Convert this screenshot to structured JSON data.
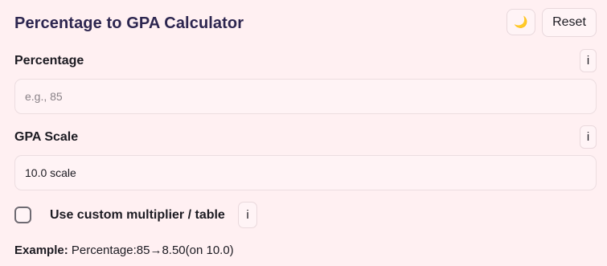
{
  "header": {
    "title": "Percentage to GPA Calculator",
    "theme_toggle_icon": "moon-icon",
    "reset_label": "Reset"
  },
  "percentage": {
    "label": "Percentage",
    "info_label": "i",
    "value": "",
    "placeholder": "e.g., 85"
  },
  "gpa_scale": {
    "label": "GPA Scale",
    "info_label": "i",
    "selected": "10.0 scale"
  },
  "custom": {
    "checked": false,
    "label": "Use custom multiplier / table",
    "info_label": "i"
  },
  "example": {
    "prefix": "Example:",
    "text": " Percentage:85→8.50(on 10.0)"
  }
}
